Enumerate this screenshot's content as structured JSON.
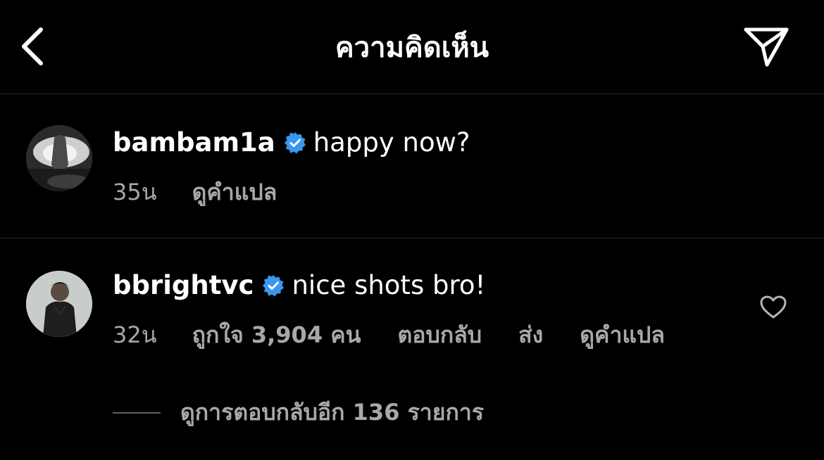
{
  "header": {
    "title": "ความคิดเห็น",
    "back_icon": "chevron-left-icon",
    "share_icon": "paper-plane-icon"
  },
  "comments": [
    {
      "username": "bambam1a",
      "verified": true,
      "text": "happy now?",
      "time": "35น",
      "translate_label": "ดูคำแปล"
    },
    {
      "username": "bbrightvc",
      "verified": true,
      "text": "nice shots bro!",
      "time": "32น",
      "likes_label": "ถูกใจ 3,904 คน",
      "reply_label": "ตอบกลับ",
      "send_label": "ส่ง",
      "translate_label": "ดูคำแปล",
      "view_replies_label": "ดูการตอบกลับอีก 136 รายการ"
    }
  ],
  "colors": {
    "background": "#000000",
    "text_primary": "#ffffff",
    "text_secondary": "#a8a8a8",
    "verified_badge": "#3897f0",
    "divider": "#262626"
  }
}
